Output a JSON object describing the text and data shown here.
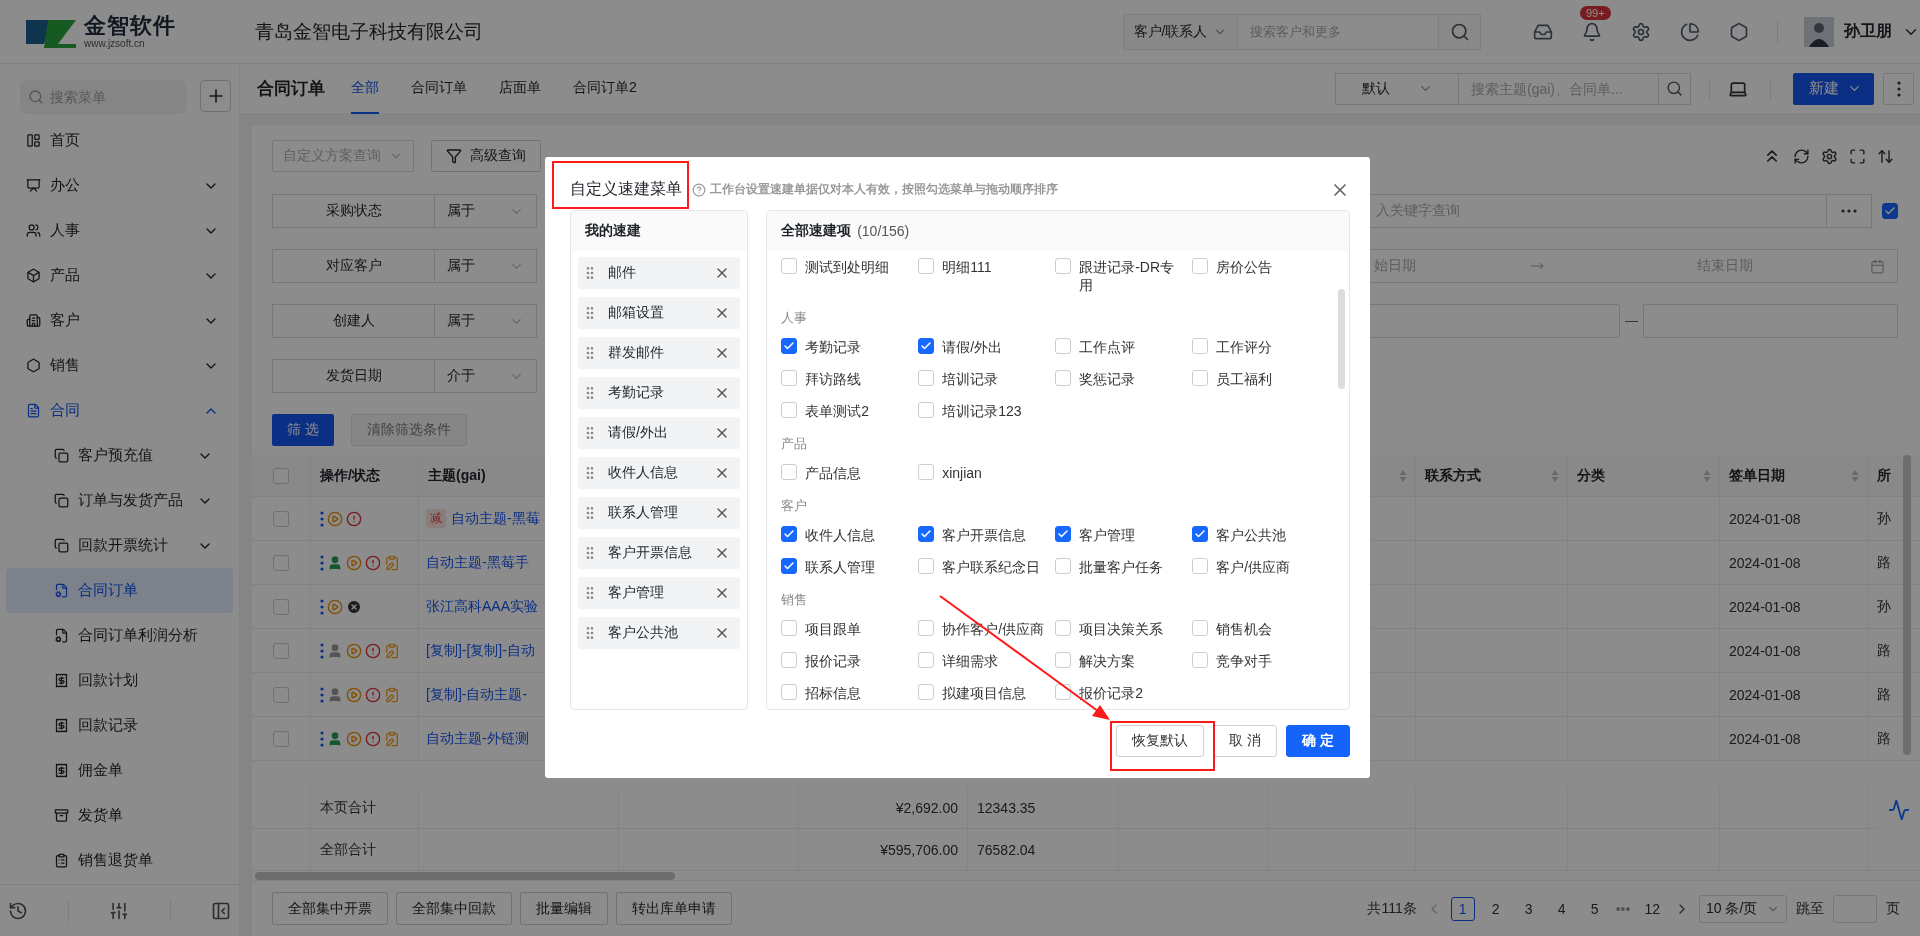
{
  "header": {
    "logo_title": "金智软件",
    "logo_url": "www.jzsoft.cn",
    "company": "青岛金智电子科技有限公司",
    "search_scope": "客户/联系人",
    "search_placeholder": "搜索客户和更多",
    "notification_count": "99+",
    "user_name": "孙卫朋"
  },
  "sidebar": {
    "search_placeholder": "搜索菜单",
    "items": [
      {
        "label": "首页",
        "selected": false
      },
      {
        "label": "办公",
        "selected": false,
        "expanded": false
      },
      {
        "label": "人事",
        "selected": false,
        "expanded": false
      },
      {
        "label": "产品",
        "selected": false,
        "expanded": false
      },
      {
        "label": "客户",
        "selected": false,
        "expanded": false
      },
      {
        "label": "销售",
        "selected": false,
        "expanded": false
      },
      {
        "label": "合同",
        "selected": false,
        "expanded": true,
        "children": [
          {
            "label": "客户预充值",
            "selected": false,
            "expanded": false
          },
          {
            "label": "订单与发货产品",
            "selected": false,
            "expanded": false
          },
          {
            "label": "回款开票统计",
            "selected": false,
            "expanded": false
          },
          {
            "label": "合同订单",
            "selected": true
          },
          {
            "label": "合同订单利润分析",
            "selected": false
          },
          {
            "label": "回款计划",
            "selected": false
          },
          {
            "label": "回款记录",
            "selected": false
          },
          {
            "label": "佣金单",
            "selected": false
          },
          {
            "label": "发货单",
            "selected": false
          },
          {
            "label": "销售退货单",
            "selected": false
          }
        ]
      }
    ]
  },
  "page": {
    "title": "合同订单",
    "tabs": [
      {
        "label": "全部",
        "selected": true
      },
      {
        "label": "合同订单",
        "selected": false
      },
      {
        "label": "店面单",
        "selected": false
      },
      {
        "label": "合同订单2",
        "selected": false
      }
    ],
    "view_select": "默认",
    "search_placeholder": "搜索主题(gai)、合同单...",
    "new_button": "新建"
  },
  "filters": {
    "scheme_placeholder": "自定义方案查询",
    "advanced_button": "高级查询",
    "rows": [
      {
        "label": "采购状态",
        "operator": "属于",
        "kind": "keyword",
        "placeholder": "入关键字查询",
        "checked": true
      },
      {
        "label": "对应客户",
        "operator": "属于",
        "kind": "date",
        "start_placeholder": "始日期",
        "end_placeholder": "结束日期"
      },
      {
        "label": "创建人",
        "operator": "属于",
        "kind": "range"
      },
      {
        "label": "发货日期",
        "operator": "介于",
        "kind": "hidden"
      }
    ],
    "apply_button": "筛 选",
    "clear_button": "清除筛选条件",
    "clear_disabled": true
  },
  "table": {
    "all_selected": false,
    "columns": [
      {
        "title": "操作/状态",
        "sortable": false
      },
      {
        "title": "主题(gai)",
        "sortable": false
      },
      {
        "sortable": true
      },
      {
        "title": "联系方式",
        "sortable": true
      },
      {
        "title": "分类",
        "sortable": true
      },
      {
        "title": "签单日期",
        "sortable": true
      },
      {
        "title": "所",
        "sortable": false
      }
    ],
    "rows": [
      {
        "selected": false,
        "status_icons": [
          {
            "kind": "more"
          },
          {
            "kind": "play"
          },
          {
            "kind": "alert"
          }
        ],
        "tag": "减",
        "subject": "自动主题-黑莓",
        "sign_date": "2024-01-08",
        "owner": "孙"
      },
      {
        "selected": false,
        "status_icons": [
          {
            "kind": "more"
          },
          {
            "kind": "person",
            "active": true
          },
          {
            "kind": "play"
          },
          {
            "kind": "alert"
          },
          {
            "kind": "memo"
          }
        ],
        "subject": "自动主题-黑莓手",
        "sign_date": "2024-01-08",
        "owner": "路"
      },
      {
        "selected": false,
        "status_icons": [
          {
            "kind": "more"
          },
          {
            "kind": "play"
          },
          {
            "kind": "closed"
          }
        ],
        "subject": "张江高科AAA实验",
        "sign_date": "2024-01-08",
        "owner": "孙"
      },
      {
        "selected": false,
        "status_icons": [
          {
            "kind": "more"
          },
          {
            "kind": "person",
            "active": false
          },
          {
            "kind": "play"
          },
          {
            "kind": "alert"
          },
          {
            "kind": "memo"
          }
        ],
        "subject": "[复制]-[复制]-自动",
        "sign_date": "2024-01-08",
        "owner": "路"
      },
      {
        "selected": false,
        "status_icons": [
          {
            "kind": "more"
          },
          {
            "kind": "person",
            "active": false
          },
          {
            "kind": "play"
          },
          {
            "kind": "alert"
          },
          {
            "kind": "memo"
          }
        ],
        "subject": "[复制]-自动主题-",
        "sign_date": "2024-01-08",
        "owner": "路"
      },
      {
        "selected": false,
        "status_icons": [
          {
            "kind": "more"
          },
          {
            "kind": "person",
            "active": true
          },
          {
            "kind": "play"
          },
          {
            "kind": "alert"
          },
          {
            "kind": "memo"
          }
        ],
        "subject": "自动主题-外链测",
        "sign_date": "2024-01-08",
        "owner": "路"
      }
    ],
    "totals": [
      {
        "label": "本页合计",
        "amount": "¥2,692.00",
        "quantity": "12343.35"
      },
      {
        "label": "全部合计",
        "amount": "¥595,706.00",
        "quantity": "76582.04"
      }
    ]
  },
  "footer": {
    "actions": [
      "全部集中开票",
      "全部集中回款",
      "批量编辑",
      "转出库单申请"
    ],
    "pagination": {
      "total": "共111条",
      "pages": [
        {
          "kind": "page",
          "label": "1",
          "selected": true
        },
        {
          "kind": "page",
          "label": "2",
          "selected": false
        },
        {
          "kind": "page",
          "label": "3",
          "selected": false
        },
        {
          "kind": "page",
          "label": "4",
          "selected": false
        },
        {
          "kind": "page",
          "label": "5",
          "selected": false
        },
        {
          "kind": "ellipsis",
          "label": "•••"
        },
        {
          "kind": "page",
          "label": "12",
          "selected": false
        }
      ],
      "page_size": "10 条/页",
      "jump_label": "跳至",
      "page_unit": "页"
    }
  },
  "dialog": {
    "title": "自定义速建菜单",
    "hint": "工作台设置速建单据仅对本人有效，按照勾选菜单与拖动顺序排序",
    "my_title": "我的速建",
    "my_items": [
      "邮件",
      "邮箱设置",
      "群发邮件",
      "考勤记录",
      "请假/外出",
      "收件人信息",
      "联系人管理",
      "客户开票信息",
      "客户管理",
      "客户公共池"
    ],
    "all_title": "全部速建项",
    "all_count": "(10/156)",
    "groups": [
      {
        "items": [
          {
            "label": "测试到处明细",
            "checked": false
          },
          {
            "label": "明细111",
            "checked": false
          },
          {
            "label": "跟进记录-DR专用",
            "checked": false
          },
          {
            "label": "房价公告",
            "checked": false
          }
        ]
      },
      {
        "label": "人事",
        "items": [
          {
            "label": "考勤记录",
            "checked": true
          },
          {
            "label": "请假/外出",
            "checked": true
          },
          {
            "label": "工作点评",
            "checked": false
          },
          {
            "label": "工作评分",
            "checked": false
          },
          {
            "label": "拜访路线",
            "checked": false
          },
          {
            "label": "培训记录",
            "checked": false
          },
          {
            "label": "奖惩记录",
            "checked": false
          },
          {
            "label": "员工福利",
            "checked": false
          },
          {
            "label": "表单测试2",
            "checked": false
          },
          {
            "label": "培训记录123",
            "checked": false
          }
        ]
      },
      {
        "label": "产品",
        "items": [
          {
            "label": "产品信息",
            "checked": false
          },
          {
            "label": "xinjian",
            "checked": false
          }
        ]
      },
      {
        "label": "客户",
        "items": [
          {
            "label": "收件人信息",
            "checked": true
          },
          {
            "label": "客户开票信息",
            "checked": true
          },
          {
            "label": "客户管理",
            "checked": true
          },
          {
            "label": "客户公共池",
            "checked": true
          },
          {
            "label": "联系人管理",
            "checked": true
          },
          {
            "label": "客户联系纪念日",
            "checked": false
          },
          {
            "label": "批量客户任务",
            "checked": false
          },
          {
            "label": "客户/供应商",
            "checked": false
          }
        ]
      },
      {
        "label": "销售",
        "items": [
          {
            "label": "项目跟单",
            "checked": false
          },
          {
            "label": "协作客户/供应商",
            "checked": false
          },
          {
            "label": "项目决策关系",
            "checked": false
          },
          {
            "label": "销售机会",
            "checked": false
          },
          {
            "label": "报价记录",
            "checked": false
          },
          {
            "label": "详细需求",
            "checked": false
          },
          {
            "label": "解决方案",
            "checked": false
          },
          {
            "label": "竞争对手",
            "checked": false
          },
          {
            "label": "招标信息",
            "checked": false
          },
          {
            "label": "拟建项目信息",
            "checked": false
          },
          {
            "label": "报价记录2",
            "checked": false
          }
        ]
      }
    ],
    "buttons": [
      {
        "label": "恢复默认",
        "kind": "default"
      },
      {
        "label": "取 消",
        "kind": "default"
      },
      {
        "label": "确 定",
        "kind": "primary"
      }
    ]
  },
  "annotations": [
    {
      "kind": "frame"
    },
    {
      "kind": "frame"
    },
    {
      "kind": "arrow"
    }
  ]
}
